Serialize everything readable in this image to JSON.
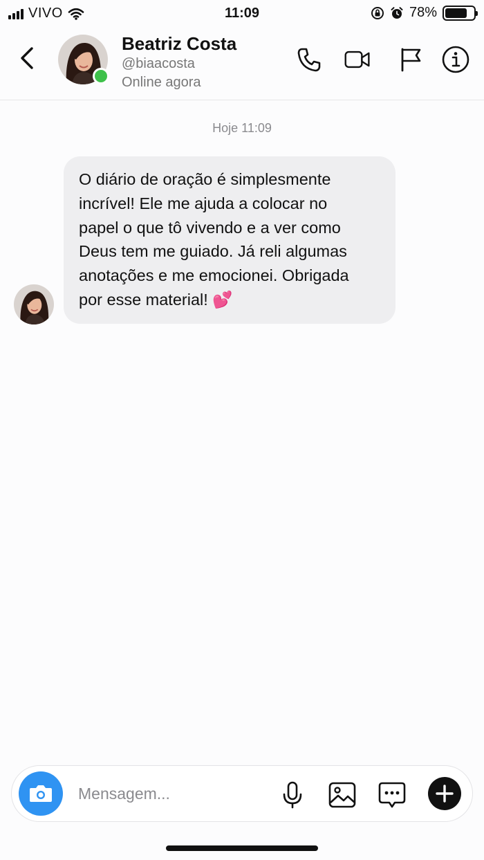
{
  "status_bar": {
    "carrier": "VIVO",
    "time": "11:09",
    "battery_percent": "78%",
    "battery_level": 0.78,
    "icons": [
      "signal-icon",
      "wifi-icon",
      "orientation-lock-icon",
      "alarm-icon",
      "battery-icon"
    ]
  },
  "header": {
    "name": "Beatriz Costa",
    "handle": "@biaacosta",
    "status": "Online agora",
    "icons": [
      "back-icon",
      "phone-icon",
      "video-icon",
      "flag-icon",
      "info-icon"
    ]
  },
  "conversation": {
    "timestamp": "Hoje 11:09",
    "messages": [
      {
        "text": "O diário de oração é simplesmente\nincrível! Ele me ajuda a colocar no\npapel o que tô vivendo e a ver como\nDeus tem me guiado. Já reli algumas\nanotações e me emocionei. Obrigada\npor esse material! 💕"
      }
    ]
  },
  "composer": {
    "placeholder": "Mensagem...",
    "value": "",
    "icons": [
      "camera-icon",
      "microphone-icon",
      "gallery-icon",
      "sticker-icon",
      "plus-icon"
    ]
  },
  "colors": {
    "accent_blue": "#2f93f2",
    "online_green": "#3ec14a",
    "bubble_gray": "#eeeef0"
  }
}
